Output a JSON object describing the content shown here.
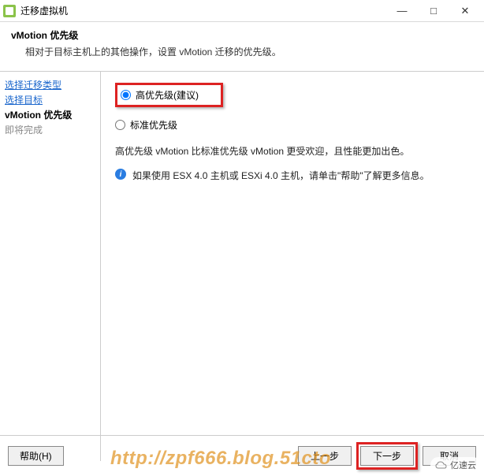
{
  "window": {
    "title": "迁移虚拟机",
    "minimize": "—",
    "maximize": "□",
    "close": "✕"
  },
  "header": {
    "title": "vMotion 优先级",
    "subtitle": "相对于目标主机上的其他操作，设置 vMotion 迁移的优先级。"
  },
  "sidebar": {
    "step1": "选择迁移类型",
    "step2": "选择目标",
    "step3": "vMotion 优先级",
    "step4": "即将完成"
  },
  "main": {
    "radio_high": "高优先级(建议)",
    "radio_standard": "标准优先级",
    "description": "高优先级 vMotion 比标准优先级 vMotion 更受欢迎，且性能更加出色。",
    "info": "如果使用 ESX 4.0 主机或 ESXi 4.0 主机，请单击\"帮助\"了解更多信息。"
  },
  "footer": {
    "help": "帮助(H)",
    "back": "上一步",
    "next": "下一步",
    "cancel": "取消"
  },
  "watermark": "http://zpf666.blog.51cto",
  "logo": "亿速云"
}
